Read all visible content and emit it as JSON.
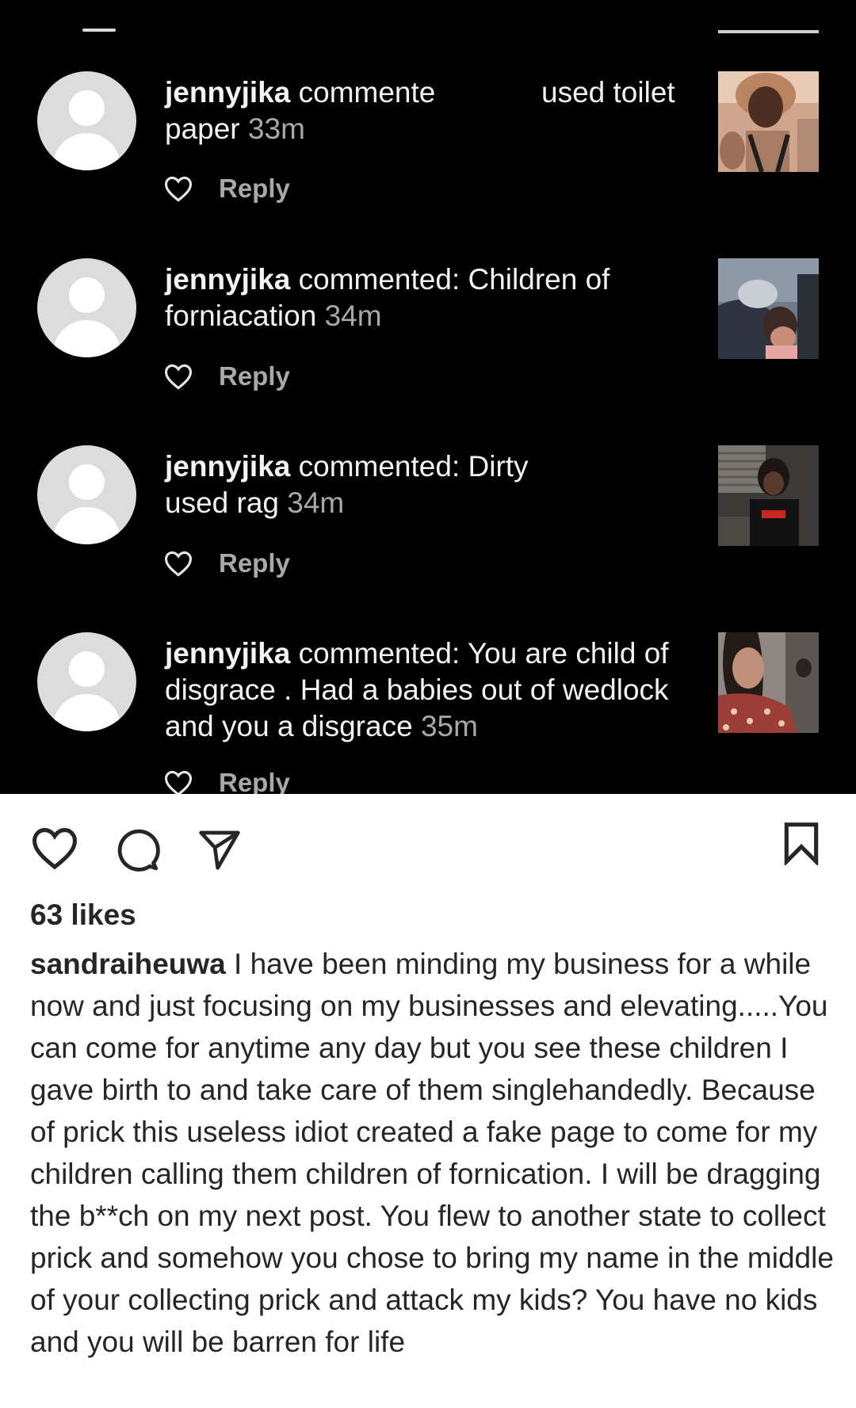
{
  "notifications": [
    {
      "username": "jennyjika",
      "text": " commente             used toilet paper",
      "time": "33m",
      "reply_label": "Reply"
    },
    {
      "username": "jennyjika",
      "text": " commented: Children of forniacation",
      "time": "34m",
      "reply_label": "Reply"
    },
    {
      "username": "jennyjika",
      "text": " commented: Dirty                 used rag",
      "time": "34m",
      "reply_label": "Reply"
    },
    {
      "username": "jennyjika",
      "text": " commented: You are child of disgrace . Had a babies out of wedlock and you a disgrace",
      "time": "35m",
      "reply_label": "Reply"
    }
  ],
  "post": {
    "likes": "63 likes",
    "caption_user": "sandraiheuwa",
    "caption_text": " I have been minding my business for a while now and just focusing on my businesses and elevating.....You can come for anytime any day but you see these children I gave birth to and take care of them singlehandedly. Because of prick this useless idiot created a fake page to come for my children calling them children of fornication. I will be dragging the b**ch on my next post. You flew to another state to collect prick and somehow you chose to bring my name in the middle of your collecting prick and attack my kids? You have no kids and you will be barren for life"
  },
  "icons": {
    "like": "heart-icon",
    "comment": "comment-bubble-icon",
    "share": "paper-plane-icon",
    "save": "bookmark-icon",
    "notification_like": "heart-outline-icon",
    "avatar": "default-avatar-icon"
  },
  "colors": {
    "notification_background": "#000000",
    "notification_text": "#f2f2f2",
    "secondary_text": "#a8a8a8",
    "avatar_placeholder": "#dcdcdc",
    "post_background": "#ffffff",
    "post_text": "#262626"
  }
}
